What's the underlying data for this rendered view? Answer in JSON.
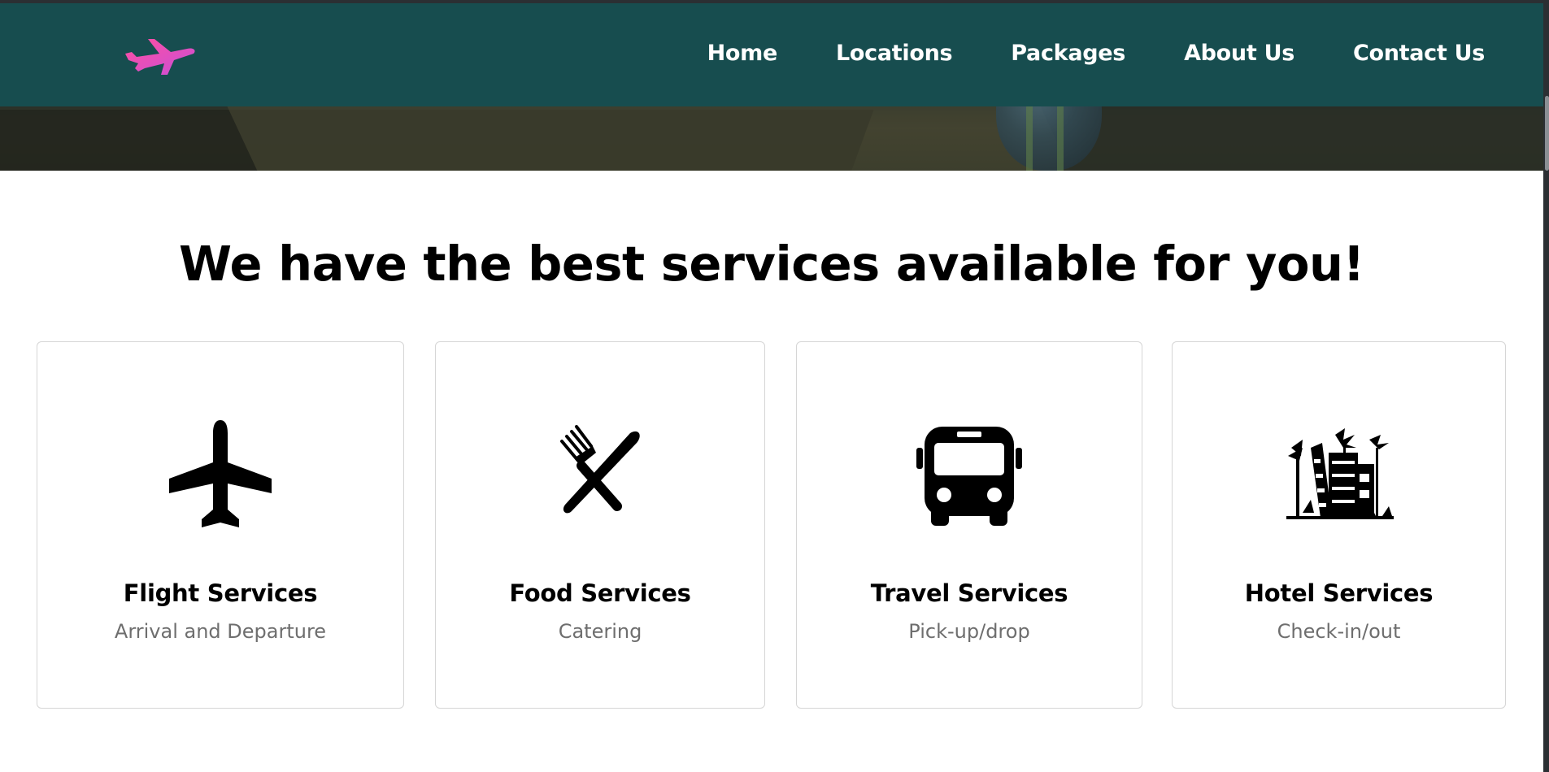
{
  "nav": {
    "logo_icon": "airplane-logo-icon",
    "links": [
      {
        "label": "Home"
      },
      {
        "label": "Locations"
      },
      {
        "label": "Packages"
      },
      {
        "label": "About Us"
      },
      {
        "label": "Contact Us"
      }
    ]
  },
  "services": {
    "heading": "We have the best services available for you!",
    "cards": [
      {
        "icon": "airplane-icon",
        "title": "Flight Services",
        "subtitle": "Arrival and Departure"
      },
      {
        "icon": "fork-knife-icon",
        "title": "Food Services",
        "subtitle": "Catering"
      },
      {
        "icon": "bus-icon",
        "title": "Travel Services",
        "subtitle": "Pick-up/drop"
      },
      {
        "icon": "hotel-icon",
        "title": "Hotel Services",
        "subtitle": "Check-in/out"
      }
    ]
  },
  "colors": {
    "navbar_bg": "#174d4f",
    "logo_gradient_start": "#ff4fa0",
    "logo_gradient_end": "#c94fd8",
    "heading_text": "#000000",
    "subtitle_text": "#6e6e6e"
  }
}
